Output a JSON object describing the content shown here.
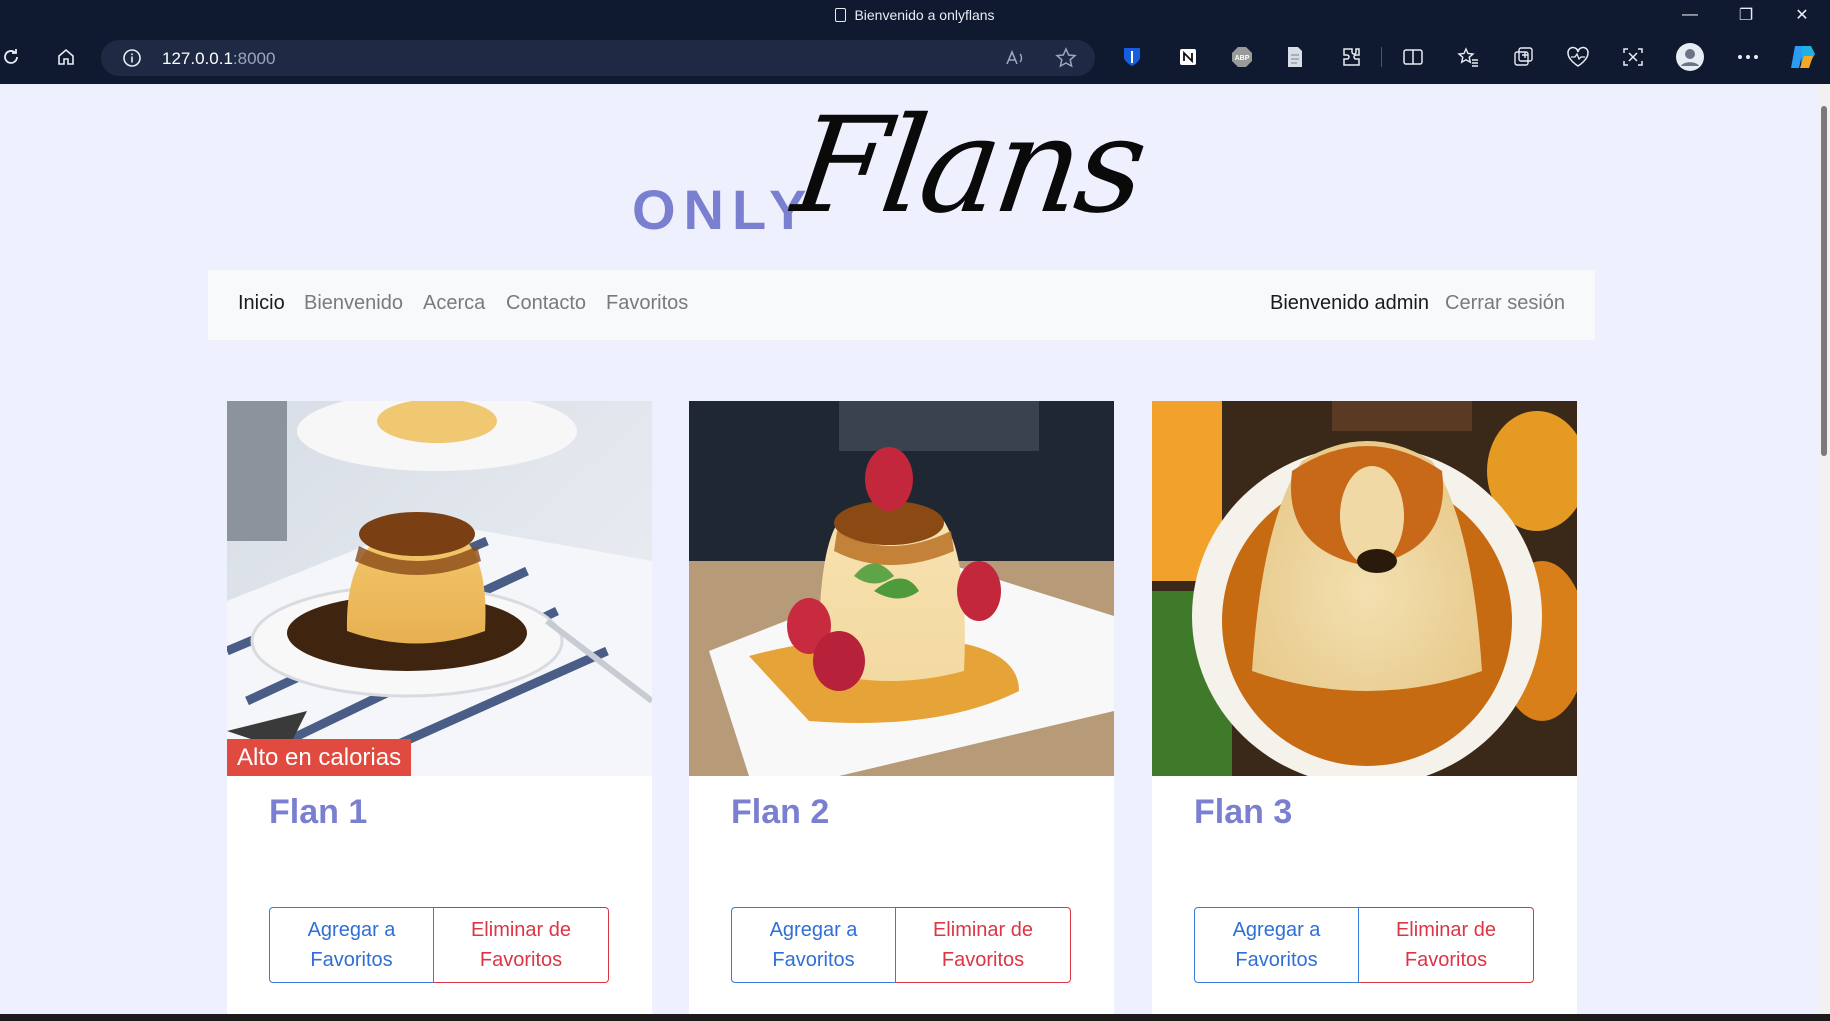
{
  "browser": {
    "tab_title": "Bienvenido a onlyflans",
    "url_host": "127.0.0.1",
    "url_port": ":8000",
    "window_controls": {
      "minimize": "—",
      "restore": "❐",
      "close": "✕"
    },
    "toolbar_icons": [
      "refresh-icon",
      "home-icon",
      "info-icon",
      "read-aloud-icon",
      "favorite-star-icon",
      "bitwarden-icon",
      "notion-icon",
      "adblock-icon",
      "document-icon",
      "extensions-icon",
      "split-screen-icon",
      "favorites-icon",
      "collections-icon",
      "browser-essentials-icon",
      "screenshot-icon",
      "profile-icon",
      "more-icon",
      "copilot-icon"
    ]
  },
  "logo": {
    "only": "ONLY",
    "flans": "Flans"
  },
  "nav": {
    "items": [
      {
        "label": "Inicio",
        "active": true
      },
      {
        "label": "Bienvenido",
        "active": false
      },
      {
        "label": "Acerca",
        "active": false
      },
      {
        "label": "Contacto",
        "active": false
      },
      {
        "label": "Favoritos",
        "active": false
      }
    ],
    "user_greeting": "Bienvenido admin",
    "logout": "Cerrar sesión"
  },
  "cards": [
    {
      "title": "Flan 1",
      "badge": "Alto en calorias",
      "add_label": "Agregar a Favoritos",
      "remove_label": "Eliminar de Favoritos"
    },
    {
      "title": "Flan 2",
      "badge": "",
      "add_label": "Agregar a Favoritos",
      "remove_label": "Eliminar de Favoritos"
    },
    {
      "title": "Flan 3",
      "badge": "",
      "add_label": "Agregar a Favoritos",
      "remove_label": "Eliminar de Favoritos"
    }
  ],
  "colors": {
    "chrome_bg": "#0f1a30",
    "page_bg": "#eef0fd",
    "brand_purple": "#7a7fcf",
    "primary_blue": "#2f6fd6",
    "danger_red": "#dc3545",
    "badge_red": "#e04a3f"
  }
}
